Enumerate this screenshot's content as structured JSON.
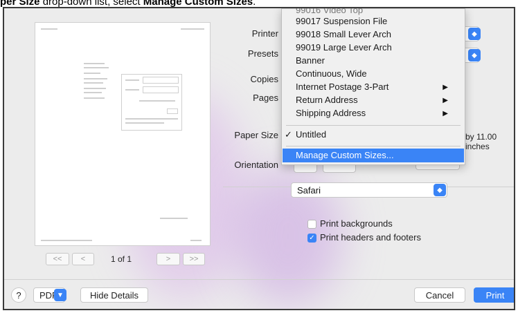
{
  "caption": {
    "pre": "per Size",
    "mid": " drop-down list, select ",
    "bold": "Manage Custom Sizes",
    "post": "."
  },
  "preview": {
    "page_indicator": "1 of 1",
    "first_btn": "<<",
    "prev_btn": "<",
    "next_btn": ">",
    "last_btn": ">>"
  },
  "labels": {
    "printer": "Printer",
    "presets": "Presets",
    "copies": "Copies",
    "pages": "Pages",
    "paper_size": "Paper Size",
    "orientation": "Orientation"
  },
  "paper_size_suffix": "by 11.00 inches",
  "menu": {
    "items": [
      {
        "label": "99016 Video Top",
        "arrow": ""
      },
      {
        "label": "99017 Suspension File",
        "arrow": ""
      },
      {
        "label": "99018 Small Lever Arch",
        "arrow": ""
      },
      {
        "label": "99019 Large Lever Arch",
        "arrow": ""
      },
      {
        "label": "Banner",
        "arrow": ""
      },
      {
        "label": "Continuous, Wide",
        "arrow": ""
      },
      {
        "label": "Internet Postage 3-Part",
        "arrow": "▶"
      },
      {
        "label": "Return Address",
        "arrow": "▶"
      },
      {
        "label": "Shipping Address",
        "arrow": "▶"
      }
    ],
    "selected_check": "✓",
    "selected": "Untitled",
    "manage": "Manage Custom Sizes..."
  },
  "app_select": "Safari",
  "options": {
    "print_backgrounds": "Print backgrounds",
    "print_headers": "Print headers and footers",
    "checkmark": "✓"
  },
  "footer": {
    "help": "?",
    "pdf": "PDF",
    "hide_details": "Hide Details",
    "cancel": "Cancel",
    "print": "Print"
  },
  "colors": {
    "accent": "#3a84f6",
    "dialog_bg": "#ececec"
  }
}
